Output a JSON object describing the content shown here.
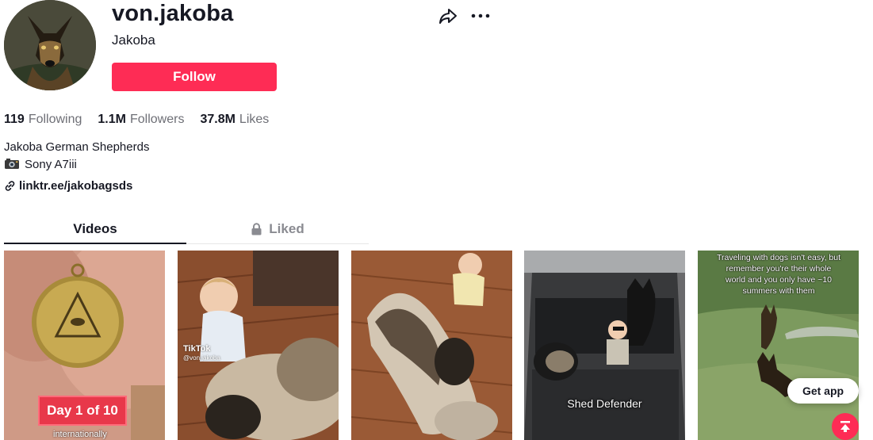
{
  "profile": {
    "username": "von.jakoba",
    "nickname": "Jakoba",
    "follow_label": "Follow"
  },
  "stats": [
    {
      "value": "119",
      "label": "Following"
    },
    {
      "value": "1.1M",
      "label": "Followers"
    },
    {
      "value": "37.8M",
      "label": "Likes"
    }
  ],
  "bio": {
    "line1": "Jakoba German Shepherds",
    "line2": "Sony A7iii",
    "link": "linktr.ee/jakobagsds"
  },
  "tabs": [
    {
      "label": "Videos",
      "active": true
    },
    {
      "label": "Liked",
      "active": false,
      "icon": "lock-icon"
    }
  ],
  "videos": [
    {
      "overlay": "Day 1 of 10",
      "caption": "internationally"
    },
    {
      "watermark": "TikTok",
      "handle": "@von.jakoba"
    },
    {},
    {
      "caption": "Shed Defender"
    },
    {
      "overlay_text": "Traveling with dogs isn't easy, but remember you're their whole world and you only have ~10 summers with them"
    }
  ],
  "floating": {
    "get_app_label": "Get app"
  },
  "colors": {
    "accent": "#fe2c55",
    "text": "#161823",
    "muted": "#6e6f76"
  },
  "icons": [
    "share-icon",
    "more-icon",
    "camera-icon",
    "link-icon",
    "lock-icon",
    "arrow-up-icon"
  ]
}
